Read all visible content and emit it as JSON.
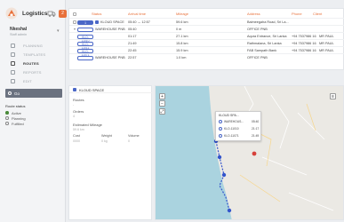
{
  "brand": {
    "name": "Logistics",
    "badge": "2"
  },
  "user": {
    "name": "Nkeshal",
    "role": "Staff admin"
  },
  "nav": [
    {
      "label": "PLANNING",
      "active": false
    },
    {
      "label": "TEMPLATES",
      "active": false
    },
    {
      "label": "ROUTES",
      "active": true
    },
    {
      "label": "REPORTS",
      "active": false
    },
    {
      "label": "EDIT",
      "active": false
    }
  ],
  "sidebar_search": {
    "label": "Go"
  },
  "status_filter": {
    "title": "Route status",
    "options": [
      {
        "label": "Active",
        "selected": true
      },
      {
        "label": "Planning",
        "selected": false
      },
      {
        "label": "Fulfilled",
        "selected": false
      }
    ]
  },
  "table": {
    "headers": [
      "Status",
      "Arrival time",
      "Mileage",
      "Address",
      "Phone",
      "Client"
    ],
    "rows": [
      {
        "id": "1",
        "id_style": "filled",
        "name": "KLOUD SPACE",
        "arrival": "05:40 → 12:57",
        "mileage": "59.6 km",
        "address": "Balmeegaha Road, Sri La...",
        "phone": "",
        "client": "",
        "chevron": "▾",
        "has_cloud": true
      },
      {
        "id": "",
        "id_style": "outline",
        "name": "WAREHOUSE PNB",
        "arrival": "05:40",
        "mileage": "0 m",
        "address": "OFFICE PNB",
        "phone": "",
        "client": "",
        "chevron": "",
        "has_cloud": false
      },
      {
        "id": "KLO-11010",
        "id_style": "outline",
        "name": "",
        "arrival": "01:17",
        "mileage": "27.1 km",
        "address": "Aqura Entrance, Sri Lanka",
        "phone": "+94 7537986 16",
        "client": "MR PAUL",
        "chevron": "",
        "has_cloud": false
      },
      {
        "id": "KLO-11011",
        "id_style": "outline",
        "name": "",
        "arrival": "21:49",
        "mileage": "15.8 km",
        "address": "Rathmalana, Sri Lanka",
        "phone": "+94 7537986 16",
        "client": "MR PAUL",
        "chevron": "",
        "has_cloud": false
      },
      {
        "id": "KLO-11071",
        "id_style": "outline",
        "name": "",
        "arrival": "22:45",
        "mileage": "15.9 km",
        "address": "FAB Sampath Bank",
        "phone": "+94 7537986 16",
        "client": "MR PAUL",
        "chevron": "",
        "has_cloud": false
      },
      {
        "id": "",
        "id_style": "outline",
        "name": "WAREHOUSE PNB",
        "arrival": "22:57",
        "mileage": "1.0 km",
        "address": "OFFICE PNB",
        "phone": "",
        "client": "",
        "chevron": "",
        "has_cloud": false
      }
    ]
  },
  "detail": {
    "title": "KLOUD SPACE",
    "routes_label": "Routes",
    "routes_value": "-",
    "orders_label": "Orders",
    "orders_value": "4",
    "mileage_label": "Estimated Mileage",
    "mileage_value": "59.6 km",
    "cols": [
      {
        "h": "Cost",
        "v": "0000"
      },
      {
        "h": "Weight",
        "v": "0 kg"
      },
      {
        "h": "Volume",
        "v": "0"
      }
    ]
  },
  "map": {
    "popup": {
      "title": "KLOUD SPA...",
      "rows": [
        {
          "name": "WAREHOUS...",
          "time": "05:40"
        },
        {
          "name": "KLO-11010",
          "time": "21:17"
        },
        {
          "name": "KLO-11071",
          "time": "21:49"
        }
      ]
    },
    "land_color": "#ebe9e4",
    "sea_color": "#aad3df",
    "route_color": "#3355cc"
  }
}
